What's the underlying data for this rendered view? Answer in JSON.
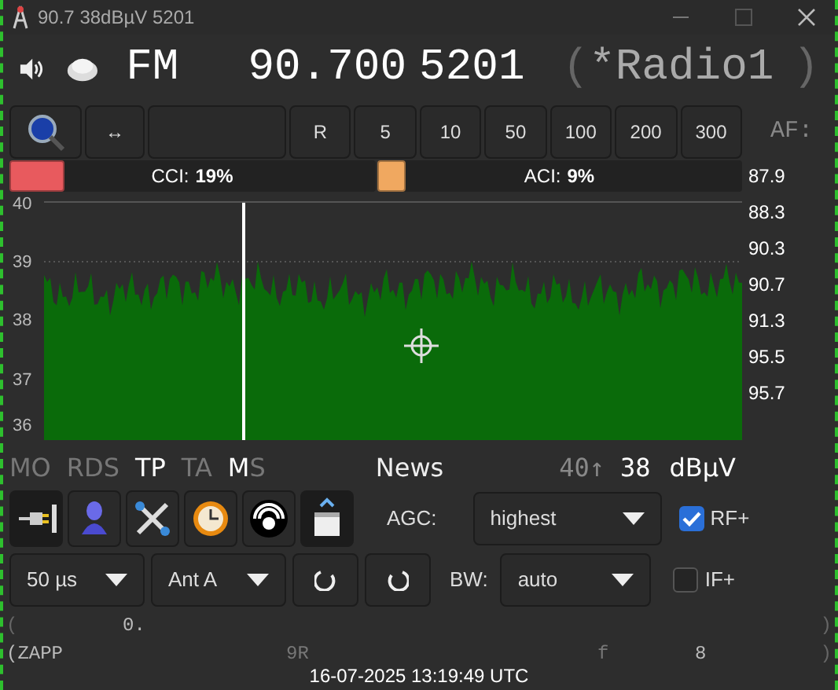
{
  "window": {
    "title": "90.7 38dBµV 5201"
  },
  "tuner": {
    "mode": "FM",
    "frequency": "90.700",
    "pi": "5201",
    "ps_open": "(",
    "ps": "*Radio1",
    "ps_close": ")"
  },
  "buttons": [
    {
      "kind": "search"
    },
    {
      "kind": "arrows",
      "label": "↔"
    },
    {
      "kind": "blank"
    },
    {
      "kind": "text",
      "label": "R"
    },
    {
      "kind": "text",
      "label": "5"
    },
    {
      "kind": "text",
      "label": "10"
    },
    {
      "kind": "text",
      "label": "50"
    },
    {
      "kind": "text",
      "label": "100"
    },
    {
      "kind": "text",
      "label": "200"
    },
    {
      "kind": "text",
      "label": "300"
    }
  ],
  "af_label": "AF:",
  "af_list": [
    "87.9",
    "88.3",
    "90.3",
    "90.7",
    "91.3",
    "95.5",
    "95.7"
  ],
  "meters": [
    {
      "label": "CCI:",
      "value": "19%",
      "level": 0.15,
      "color": "#e85a5e"
    },
    {
      "label": "ACI:",
      "value": "9%",
      "level": 0.08,
      "color": "#f0a860"
    }
  ],
  "signal_plot": {
    "y_labels": [
      "40",
      "39",
      "38",
      "37",
      "36"
    ]
  },
  "flags": [
    {
      "label": "MO",
      "on": false
    },
    {
      "label": "RDS",
      "on": false
    },
    {
      "label": "TP",
      "on": true
    },
    {
      "label": "TA",
      "on": false
    }
  ],
  "ms_flag": {
    "m": "M",
    "s": "S",
    "music": true
  },
  "pty": "News",
  "squelch": "40↑",
  "level": "38",
  "unit": "dBµV",
  "tools": [
    {
      "kind": "plug",
      "selected": true
    },
    {
      "kind": "person",
      "selected": false
    },
    {
      "kind": "tools",
      "selected": false
    },
    {
      "kind": "clock",
      "selected": false
    },
    {
      "kind": "signal",
      "selected": false
    },
    {
      "kind": "window",
      "selected": true
    }
  ],
  "agc": {
    "label": "AGC:",
    "value": "highest"
  },
  "rf_plus": {
    "label": "RF+",
    "checked": true
  },
  "deemphasis": {
    "value": "50 µs"
  },
  "antenna": {
    "value": "Ant A"
  },
  "bw": {
    "label": "BW:",
    "value": "auto"
  },
  "if_plus": {
    "label": "IF+",
    "checked": false
  },
  "rt_line1": [
    "(",
    "0.",
    ")"
  ],
  "rt_line2": [
    "(ZAPP",
    "9R",
    "f",
    "8",
    ")"
  ],
  "clock": "16-07-2025 13:19:49 UTC"
}
